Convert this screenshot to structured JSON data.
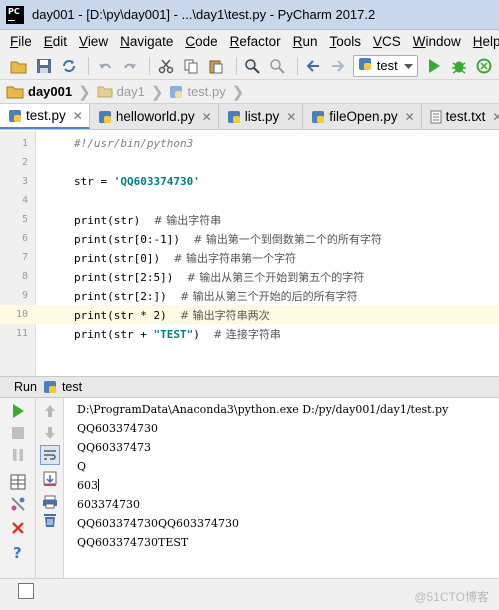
{
  "window": {
    "title": "day001 - [D:\\py\\day001] - ...\\day1\\test.py - PyCharm 2017.2",
    "logo": "PC"
  },
  "menu": [
    "File",
    "Edit",
    "View",
    "Navigate",
    "Code",
    "Refactor",
    "Run",
    "Tools",
    "VCS",
    "Window",
    "Help"
  ],
  "toolbar": {
    "run_config": "test"
  },
  "breadcrumb": [
    "day001",
    "day1",
    "test.py"
  ],
  "tabs": [
    "test.py",
    "helloworld.py",
    "list.py",
    "fileOpen.py",
    "test.txt"
  ],
  "editor": {
    "lines": [
      {
        "n": "1",
        "text": "#!/usr/bin/python3"
      },
      {
        "n": "2",
        "text": ""
      },
      {
        "n": "3",
        "text": "str = 'QQ603374730'"
      },
      {
        "n": "4",
        "text": ""
      },
      {
        "n": "5",
        "code": "print(str)",
        "comment": "# 输出字符串"
      },
      {
        "n": "6",
        "code": "print(str[0:-1])",
        "comment": "# 输出第一个到倒数第二个的所有字符"
      },
      {
        "n": "7",
        "code": "print(str[0])",
        "comment": "# 输出字符串第一个字符"
      },
      {
        "n": "8",
        "code": "print(str[2:5])",
        "comment": "# 输出从第三个开始到第五个的字符"
      },
      {
        "n": "9",
        "code": "print(str[2:])",
        "comment": "# 输出从第三个开始的后的所有字符"
      },
      {
        "n": "10",
        "code": "print(str * 2)",
        "comment": "# 输出字符串两次"
      },
      {
        "n": "11",
        "code": "print(str + \"TEST\")",
        "comment": "# 连接字符串"
      }
    ]
  },
  "run": {
    "label": "Run",
    "config": "test",
    "output": [
      "D:\\ProgramData\\Anaconda3\\python.exe D:/py/day001/day1/test.py",
      "QQ603374730",
      "QQ60337473",
      "Q",
      "603",
      "603374730",
      "QQ603374730QQ603374730",
      "QQ603374730TEST"
    ]
  },
  "watermark": "@51CTO博客",
  "colors": {
    "title_bg": "#c9d7ec",
    "accent": "#4a88d0",
    "current_line": "#fffae3"
  }
}
